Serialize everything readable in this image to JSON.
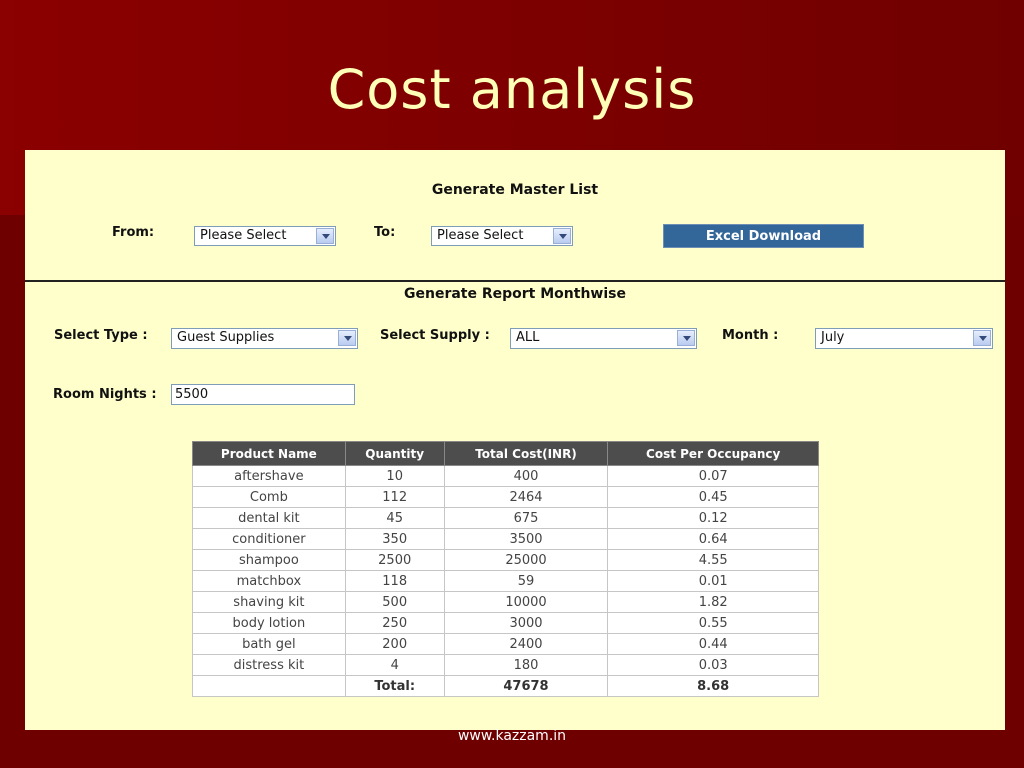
{
  "slide": {
    "title": "Cost analysis",
    "footer": "www.kazzam.in"
  },
  "master_list": {
    "heading": "Generate Master List",
    "from_label": "From:",
    "from_value": "Please Select",
    "to_label": "To:",
    "to_value": "Please Select",
    "download_label": "Excel Download"
  },
  "report": {
    "heading": "Generate Report Monthwise",
    "type_label": "Select Type :",
    "type_value": "Guest Supplies",
    "supply_label": "Select Supply :",
    "supply_value": "ALL",
    "month_label": "Month :",
    "month_value": "July",
    "room_nights_label": "Room Nights :",
    "room_nights_value": "5500"
  },
  "table": {
    "headers": [
      "Product Name",
      "Quantity",
      "Total Cost(INR)",
      "Cost Per Occupancy"
    ],
    "rows": [
      [
        "aftershave",
        "10",
        "400",
        "0.07"
      ],
      [
        "Comb",
        "112",
        "2464",
        "0.45"
      ],
      [
        "dental kit",
        "45",
        "675",
        "0.12"
      ],
      [
        "conditioner",
        "350",
        "3500",
        "0.64"
      ],
      [
        "shampoo",
        "2500",
        "25000",
        "4.55"
      ],
      [
        "matchbox",
        "118",
        "59",
        "0.01"
      ],
      [
        "shaving kit",
        "500",
        "10000",
        "1.82"
      ],
      [
        "body lotion",
        "250",
        "3000",
        "0.55"
      ],
      [
        "bath gel",
        "200",
        "2400",
        "0.44"
      ],
      [
        "distress kit",
        "4",
        "180",
        "0.03"
      ]
    ],
    "total": [
      "",
      "Total:",
      "47678",
      "8.68"
    ]
  }
}
